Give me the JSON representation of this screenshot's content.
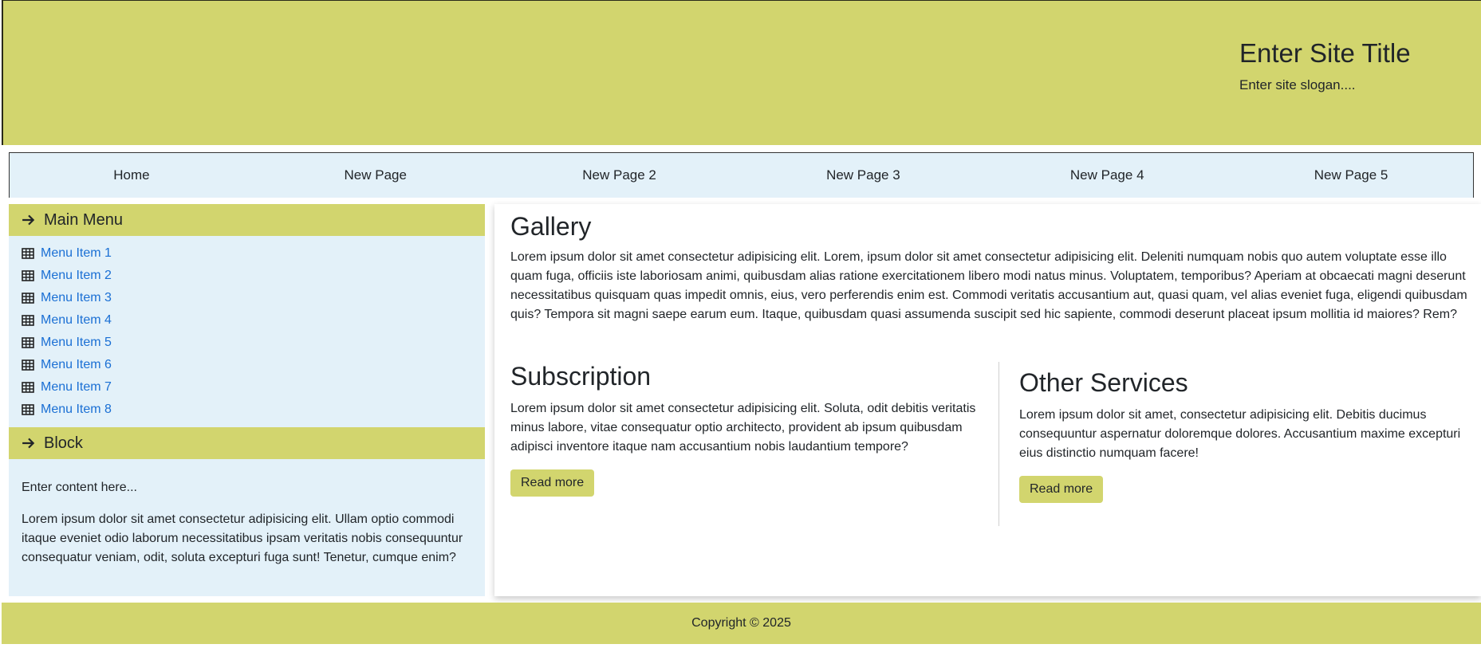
{
  "header": {
    "site_title": "Enter Site Title",
    "site_slogan": "Enter site slogan...."
  },
  "nav": {
    "items": [
      "Home",
      "New Page",
      "New Page 2",
      "New Page 3",
      "New Page 4",
      "New Page 5"
    ]
  },
  "sidebar": {
    "main_menu_title": "Main Menu",
    "menu_items": [
      "Menu Item 1",
      "Menu Item 2",
      "Menu Item 3",
      "Menu Item 4",
      "Menu Item 5",
      "Menu Item 6",
      "Menu Item 7",
      "Menu Item 8"
    ],
    "block_title": "Block",
    "block_intro": "Enter content here...",
    "block_text": "Lorem ipsum dolor sit amet consectetur adipisicing elit. Ullam optio commodi itaque eveniet odio laborum necessitatibus ipsam veritatis nobis consequuntur consequatur veniam, odit, soluta excepturi fuga sunt! Tenetur, cumque enim?"
  },
  "main": {
    "gallery_title": "Gallery",
    "gallery_text": "Lorem ipsum dolor sit amet consectetur adipisicing elit. Lorem, ipsum dolor sit amet consectetur adipisicing elit. Deleniti numquam nobis quo autem voluptate esse illo quam fuga, officiis iste laboriosam animi, quibusdam alias ratione exercitationem libero modi natus minus. Voluptatem, temporibus? Aperiam at obcaecati magni deserunt necessitatibus quisquam quas impedit omnis, eius, vero perferendis enim est. Commodi veritatis accusantium aut, quasi quam, vel alias eveniet fuga, eligendi quibusdam quis? Tempora sit magni saepe earum eum. Itaque, quibusdam quasi assumenda suscipit sed hic sapiente, commodi deserunt placeat ipsum mollitia id maiores? Rem?",
    "subscription_title": "Subscription",
    "subscription_text": "Lorem ipsum dolor sit amet consectetur adipisicing elit. Soluta, odit debitis veritatis minus labore, vitae consequatur optio architecto, provident ab ipsum quibusdam adipisci inventore itaque nam accusantium nobis laudantium tempore?",
    "subscription_button": "Read more",
    "services_title": "Other Services",
    "services_text": "Lorem ipsum dolor sit amet, consectetur adipisicing elit. Debitis ducimus consequuntur aspernatur doloremque dolores. Accusantium maxime excepturi eius distinctio numquam facere!",
    "services_button": "Read more"
  },
  "footer": {
    "copyright": "Copyright © 2025"
  },
  "colors": {
    "accent": "#d2d56e",
    "panel": "#e3f1f9",
    "link": "#1a6fd4"
  },
  "icons": {
    "section_header": "arrow-right-icon",
    "menu_item": "table-icon"
  }
}
